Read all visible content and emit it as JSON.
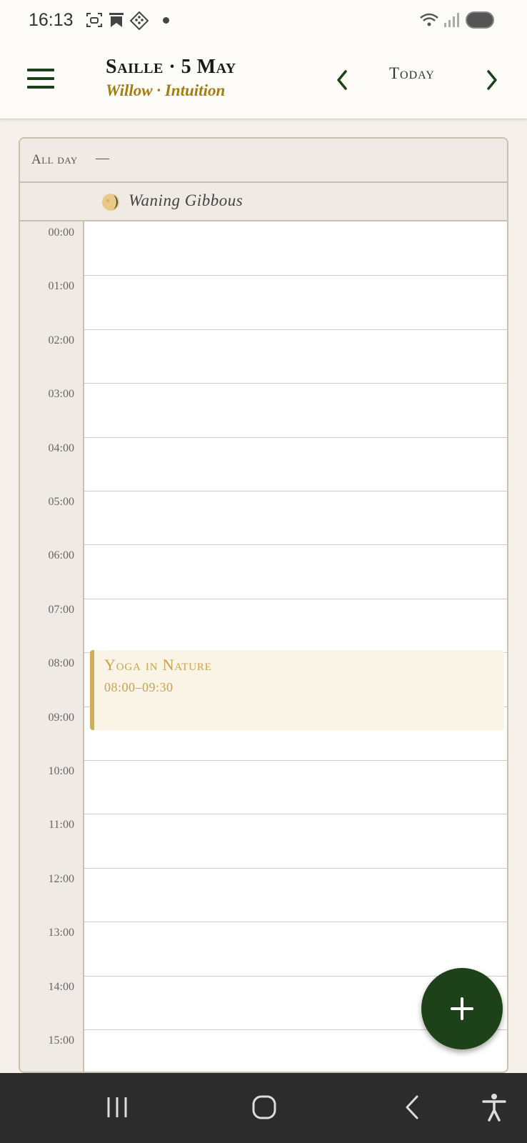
{
  "status_bar": {
    "time": "16:13",
    "icons": [
      "screenshot-icon",
      "bookmark-icon",
      "app-diamond-icon",
      "notification-dot",
      "wifi-icon",
      "signal-icon",
      "battery-icon"
    ]
  },
  "header": {
    "title": "Saille · 5 May",
    "subtitle": "Willow · Intuition",
    "today_label": "Today",
    "icons": [
      "menu-icon",
      "chevron-left-icon",
      "chevron-right-icon"
    ]
  },
  "calendar": {
    "all_day_label": "All day",
    "all_day_value": "—",
    "moon_phase": "Waning Gibbous",
    "hours": [
      "00:00",
      "01:00",
      "02:00",
      "03:00",
      "04:00",
      "05:00",
      "06:00",
      "07:00",
      "08:00",
      "09:00",
      "10:00",
      "11:00",
      "12:00",
      "13:00",
      "14:00",
      "15:00"
    ],
    "events": [
      {
        "title": "Yoga in Nature",
        "time": "08:00–09:30"
      }
    ]
  },
  "fab": {
    "icon": "plus-icon"
  },
  "system_nav": {
    "icons": [
      "recent-apps-icon",
      "home-icon",
      "back-icon",
      "accessibility-icon"
    ]
  },
  "colors": {
    "accent_green": "#1d4119",
    "subtitle_gold": "#a27d14",
    "event_gold": "#c8a24f",
    "background": "#f5f1ea"
  }
}
